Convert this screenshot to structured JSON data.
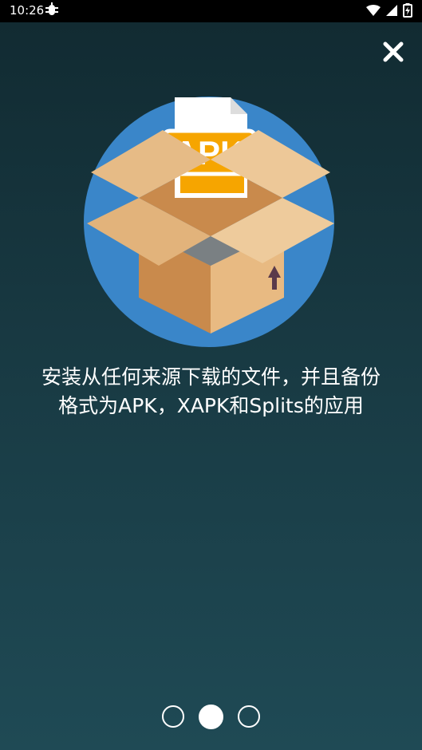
{
  "status_bar": {
    "time": "10:26",
    "app_icon": "bug-icon",
    "icons": [
      "wifi-icon",
      "cellular-signal-icon",
      "battery-icon"
    ]
  },
  "close_button": {
    "icon": "close-icon"
  },
  "illustration": {
    "file_label": "APK",
    "colors": {
      "circle": "#3a86c9",
      "box_light": "#e6bb86",
      "box_dark": "#c98a4c",
      "file_orange": "#f6a500"
    }
  },
  "description": {
    "line1": "安装从任何来源下载的文件，并且备份",
    "line2": "格式为APK，XAPK和Splits的应用"
  },
  "pager": {
    "count": 3,
    "active_index": 1
  }
}
